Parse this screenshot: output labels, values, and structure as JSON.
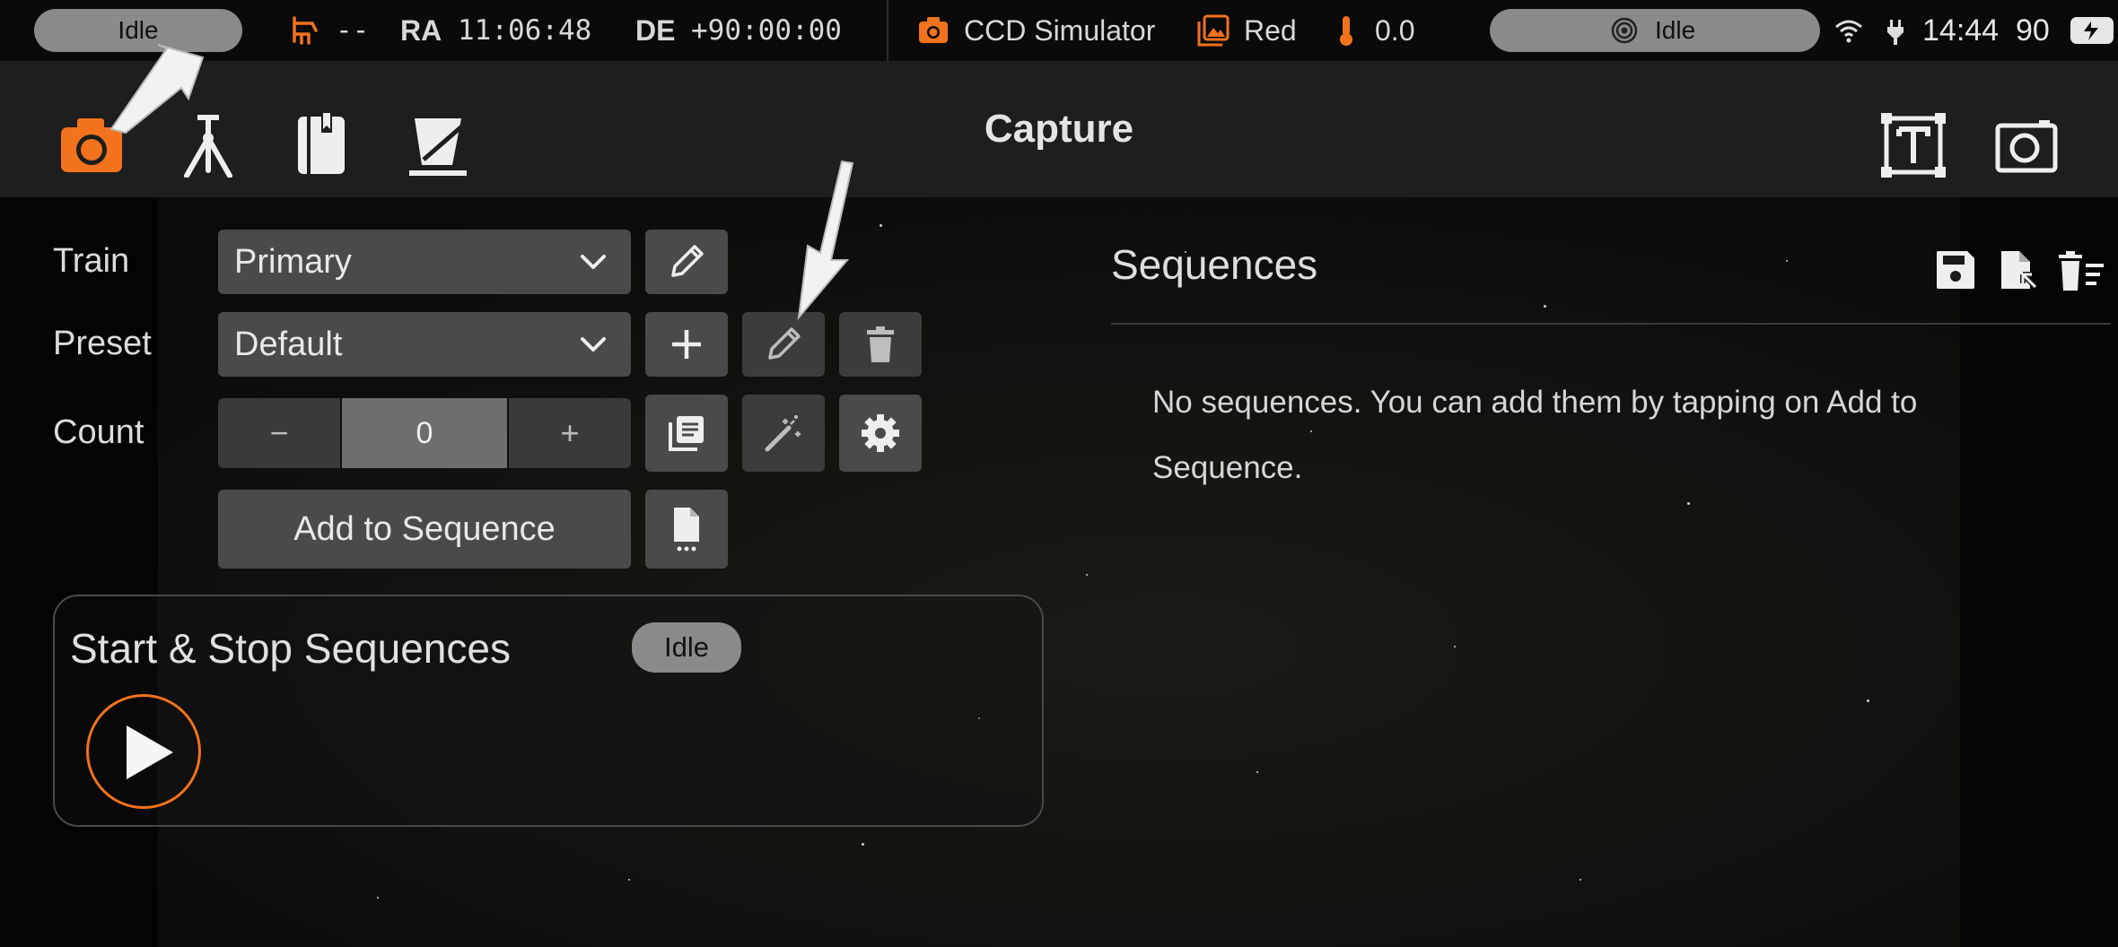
{
  "status_bar": {
    "left_status": "Idle",
    "mount_value": "--",
    "ra_label": "RA",
    "ra_value": "11:06:48",
    "de_label": "DE",
    "de_value": "+90:00:00",
    "camera_name": "CCD Simulator",
    "filter_name": "Red",
    "temperature": "0.0",
    "guide_status": "Idle",
    "time": "14:44",
    "battery": "90",
    "colors": {
      "accent": "#f2721d",
      "pill": "#8a8a8a"
    }
  },
  "toolbar": {
    "title": "Capture",
    "icons": [
      "camera-icon",
      "tripod-icon",
      "notebook-icon",
      "flat-panel-icon",
      "text-box-icon",
      "capture-frame-icon"
    ]
  },
  "form": {
    "train_label": "Train",
    "train_value": "Primary",
    "preset_label": "Preset",
    "preset_value": "Default",
    "count_label": "Count",
    "count_decrement": "−",
    "count_value": "0",
    "count_increment": "+",
    "add_to_sequence": "Add to Sequence"
  },
  "start_stop": {
    "title": "Start & Stop Sequences",
    "status": "Idle"
  },
  "sequences": {
    "title": "Sequences",
    "empty_message": "No sequences. You can add them by tapping on Add to Sequence."
  }
}
